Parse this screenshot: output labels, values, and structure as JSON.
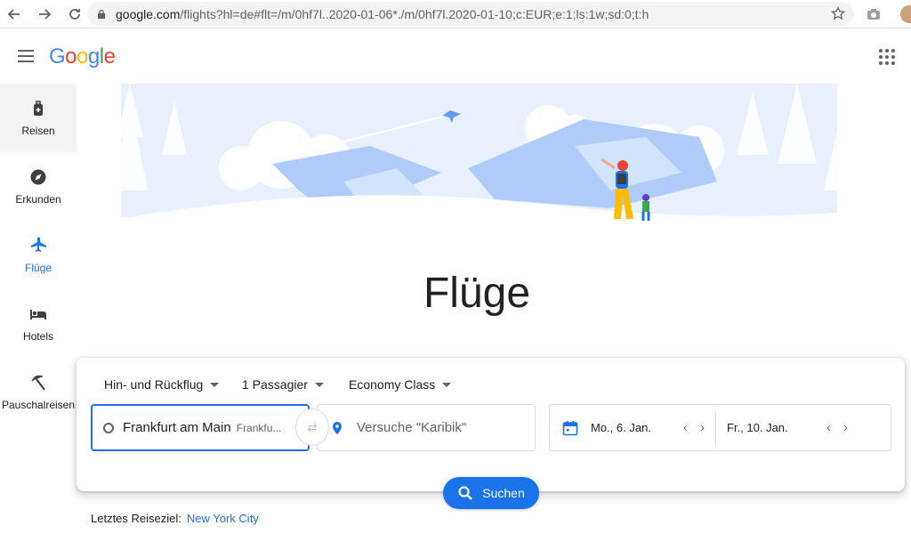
{
  "browser": {
    "url_host": "google.com",
    "url_rest": "/flights?hl=de#flt=/m/0hf7l..2020-01-06*./m/0hf7l.2020-01-10;c:EUR;e:1;ls:1w;sd:0;t:h"
  },
  "header": {
    "logo": "Google"
  },
  "sidebar": {
    "items": [
      {
        "label": "Reisen",
        "icon": "luggage-icon"
      },
      {
        "label": "Erkunden",
        "icon": "compass-icon"
      },
      {
        "label": "Flüge",
        "icon": "airplane-icon"
      },
      {
        "label": "Hotels",
        "icon": "bed-icon"
      },
      {
        "label": "Pauschalreisen",
        "icon": "beach-umbrella-icon"
      }
    ]
  },
  "page": {
    "title": "Flüge"
  },
  "search": {
    "trip_type": "Hin- und Rückflug",
    "passengers": "1 Passagier",
    "cabin": "Economy Class",
    "origin": "Frankfurt am Main",
    "origin_sub": "Frankfu...",
    "destination_placeholder": "Versuche \"Karibik\"",
    "depart_date": "Mo., 6. Jan.",
    "return_date": "Fr., 10. Jan.",
    "search_label": "Suchen"
  },
  "recent": {
    "label": "Letztes Reiseziel:",
    "link": "New York City"
  },
  "colors": {
    "accent": "#1a73e8",
    "hero_sky": "#e8f0fe",
    "hero_mountain": "#aecbfa"
  }
}
